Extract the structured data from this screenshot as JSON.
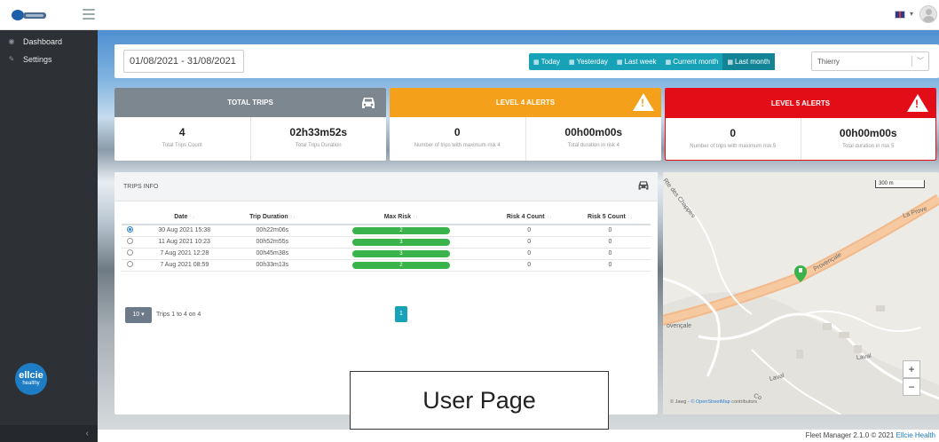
{
  "sidebar": {
    "items": [
      {
        "label": "Dashboard",
        "icon": "dashboard-icon"
      },
      {
        "label": "Settings",
        "icon": "wrench-icon"
      }
    ],
    "brand_logo": {
      "line1": "ellcie",
      "line2": "healthy"
    },
    "collapse_glyph": "‹"
  },
  "filters": {
    "date_range": "01/08/2021 - 31/08/2021",
    "quick_ranges": [
      "Today",
      "Yesterday",
      "Last week",
      "Current month",
      "Last month"
    ],
    "active_range": "Last month",
    "user_value": "Thierry"
  },
  "stats": [
    {
      "title": "TOTAL TRIPS",
      "icon": "car-icon",
      "color": "#7d8790",
      "cells": [
        {
          "value": "4",
          "label": "Total Trips Count"
        },
        {
          "value": "02h33m52s",
          "label": "Total Trips Duration"
        }
      ]
    },
    {
      "title": "LEVEL 4 ALERTS",
      "icon": "warning-icon",
      "color": "#f5a01a",
      "cells": [
        {
          "value": "0",
          "label": "Number of trips with maximum risk 4"
        },
        {
          "value": "00h00m00s",
          "label": "Total duration in risk 4"
        }
      ]
    },
    {
      "title": "LEVEL 5 ALERTS",
      "icon": "warning-icon",
      "color": "#e30d18",
      "cells": [
        {
          "value": "0",
          "label": "Number of trips with maximum risk 5"
        },
        {
          "value": "00h00m00s",
          "label": "Total duration in risk 5"
        }
      ]
    }
  ],
  "trips": {
    "title": "TRIPS INFO",
    "columns": [
      "Date",
      "Trip Duration",
      "Max Risk",
      "Risk 4 Count",
      "Risk 5 Count"
    ],
    "rows": [
      {
        "selected": true,
        "date": "30 Aug 2021 15:38",
        "duration": "00h22m06s",
        "max_risk": "2",
        "risk4": "0",
        "risk5": "0"
      },
      {
        "selected": false,
        "date": "11 Aug 2021 10:23",
        "duration": "00h52m55s",
        "max_risk": "3",
        "risk4": "0",
        "risk5": "0"
      },
      {
        "selected": false,
        "date": "7 Aug 2021 12:28",
        "duration": "00h45m38s",
        "max_risk": "3",
        "risk4": "0",
        "risk5": "0"
      },
      {
        "selected": false,
        "date": "7 Aug 2021 08:59",
        "duration": "00h33m13s",
        "max_risk": "2",
        "risk4": "0",
        "risk5": "0"
      }
    ],
    "page_size": "10",
    "pager_info": "Trips 1 to 4 on 4",
    "current_page": "1"
  },
  "map": {
    "scale": "300 m",
    "labels": [
      "Rte des Chappes",
      "La Prove",
      "Provençale",
      "ovençale",
      "Laval",
      "Laval",
      "Co"
    ],
    "attribution_prefix": "© Jawg - ",
    "attribution_link": "© OpenStreetMap",
    "attribution_suffix": " contributors",
    "zoom_in": "+",
    "zoom_out": "−"
  },
  "footer": {
    "text": "Fleet Manager 2.1.0 © 2021 ",
    "brand": "Ellcie Health"
  },
  "overlay": {
    "label": "User Page"
  }
}
